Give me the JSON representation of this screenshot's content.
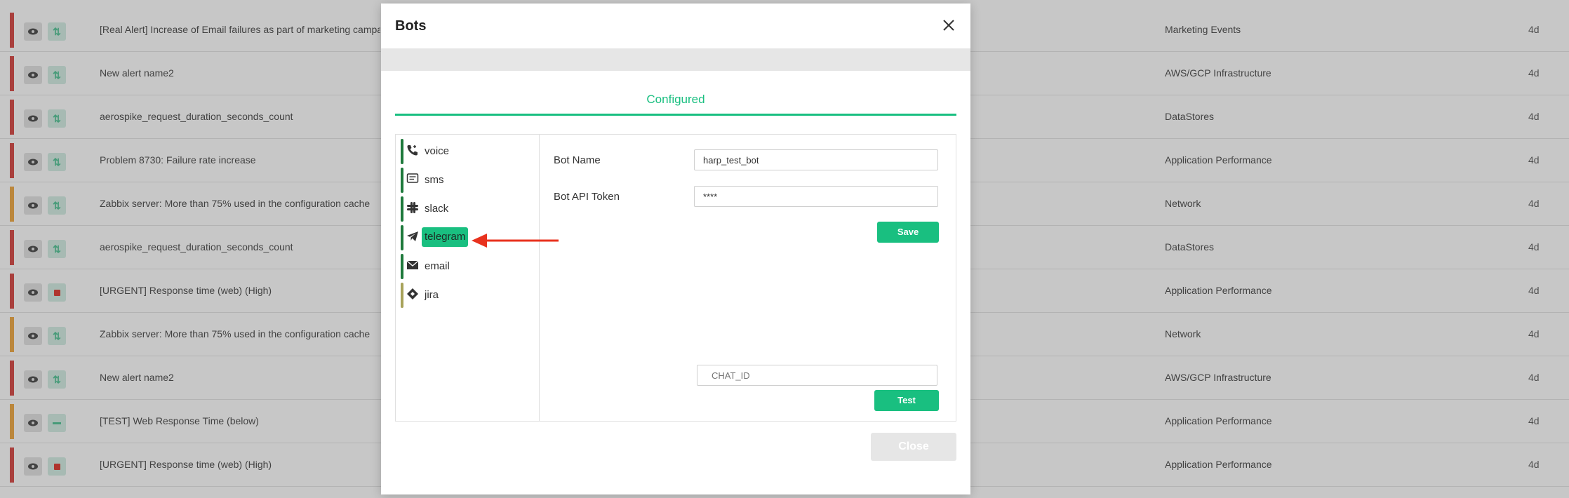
{
  "background_rows": [
    {
      "severity_color": "#d9534f",
      "action": "arrows",
      "name": "[Real Alert] Increase of Email failures as part of marketing campaign",
      "category": "Marketing Events",
      "age": "4d"
    },
    {
      "severity_color": "#d9534f",
      "action": "arrows",
      "name": "New alert name2",
      "category": "AWS/GCP Infrastructure",
      "age": "4d"
    },
    {
      "severity_color": "#d9534f",
      "action": "arrows",
      "name": "aerospike_request_duration_seconds_count",
      "category": "DataStores",
      "age": "4d"
    },
    {
      "severity_color": "#d9534f",
      "action": "arrows",
      "name": "Problem 8730: Failure rate increase",
      "category": "Application Performance",
      "age": "4d"
    },
    {
      "severity_color": "#f0ad4e",
      "action": "arrows",
      "name": "Zabbix server: More than 75% used in the configuration cache",
      "category": "Network",
      "age": "4d"
    },
    {
      "severity_color": "#d9534f",
      "action": "arrows",
      "name": "aerospike_request_duration_seconds_count",
      "category": "DataStores",
      "age": "4d"
    },
    {
      "severity_color": "#d9534f",
      "action": "stop",
      "name": "[URGENT] Response time (web) (High)",
      "category": "Application Performance",
      "age": "4d"
    },
    {
      "severity_color": "#f0ad4e",
      "action": "arrows",
      "name": "Zabbix server: More than 75% used in the configuration cache",
      "category": "Network",
      "age": "4d"
    },
    {
      "severity_color": "#d9534f",
      "action": "arrows",
      "name": "New alert name2",
      "category": "AWS/GCP Infrastructure",
      "age": "4d"
    },
    {
      "severity_color": "#f0ad4e",
      "action": "dash",
      "name": "[TEST] Web Response Time (below)",
      "category": "Application Performance",
      "age": "4d"
    },
    {
      "severity_color": "#d9534f",
      "action": "stop",
      "name": "[URGENT] Response time (web) (High)",
      "category": "Application Performance",
      "age": "4d"
    }
  ],
  "modal": {
    "title": "Bots",
    "tab_label": "Configured",
    "channels": [
      {
        "label": "voice",
        "icon": "phone-icon",
        "bar": "green"
      },
      {
        "label": "sms",
        "icon": "message-icon",
        "bar": "green"
      },
      {
        "label": "slack",
        "icon": "slack-icon",
        "bar": "green"
      },
      {
        "label": "telegram",
        "icon": "telegram-icon",
        "bar": "green",
        "selected": true
      },
      {
        "label": "email",
        "icon": "envelope-icon",
        "bar": "green"
      },
      {
        "label": "jira",
        "icon": "jira-icon",
        "bar": "olive"
      }
    ],
    "bot_name_label": "Bot Name",
    "bot_name_value": "harp_test_bot",
    "bot_token_label": "Bot API Token",
    "bot_token_value": "****",
    "save_label": "Save",
    "chat_id_placeholder": "CHAT_ID",
    "test_label": "Test",
    "close_label": "Close"
  },
  "colors": {
    "accent": "#19bf80",
    "channel_bar": "#1e7a3c",
    "channel_bar_jira": "#a7a25a",
    "annotation_arrow": "#e8321e"
  }
}
